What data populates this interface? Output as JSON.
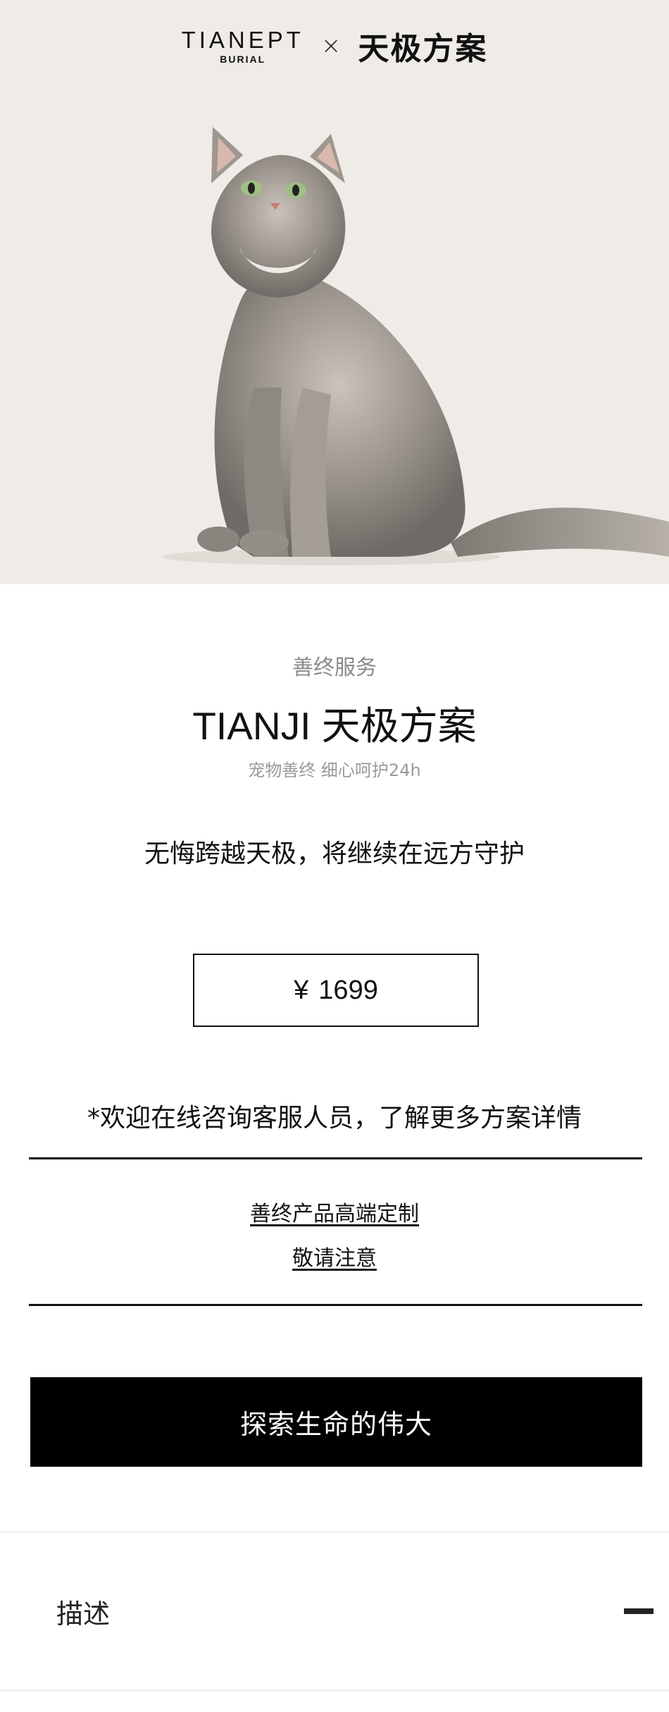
{
  "header": {
    "logo_main": "TIANEPT",
    "logo_sub": "BURIAL",
    "separator": "×",
    "brand_cn": "天极方案"
  },
  "product": {
    "kicker": "善终服务",
    "title": "TIANJI 天极方案",
    "subtitle": "宠物善终 细心呵护24h",
    "slogan": "无悔跨越天极，将继续在远方守护",
    "currency": "¥",
    "price": "1699",
    "consult_note": "*欢迎在线咨询客服人员，了解更多方案详情",
    "links": [
      "善终产品高端定制",
      "敬请注意"
    ],
    "cta_label": "探索生命的伟大"
  },
  "accordion": {
    "description_label": "描述",
    "expanded": true
  },
  "colors": {
    "hero_bg": "#efece8",
    "cta_bg": "#000000",
    "text": "#111111",
    "muted": "#8a8a8a"
  },
  "icons": [
    "cat-photo",
    "minus-icon"
  ]
}
